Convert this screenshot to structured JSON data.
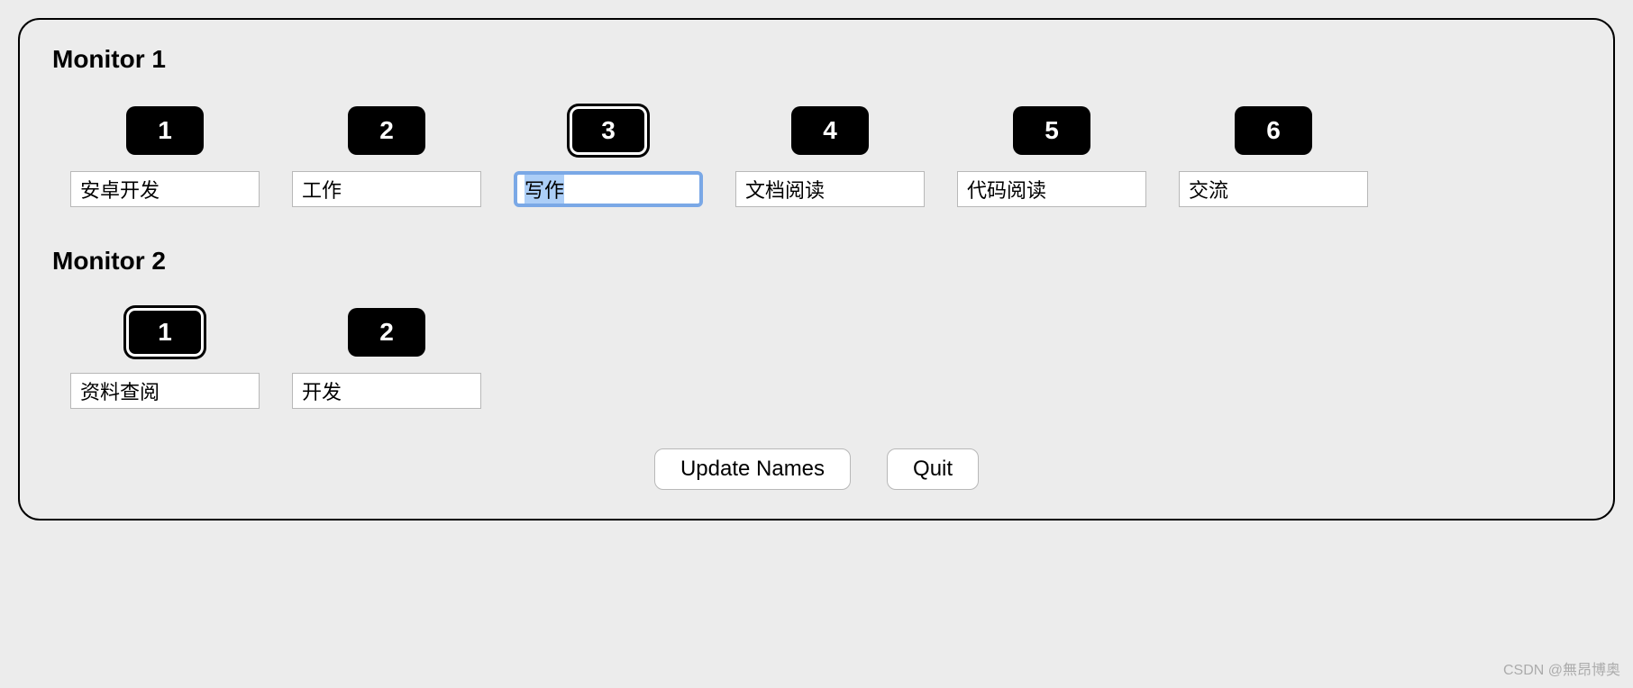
{
  "monitors": [
    {
      "heading": "Monitor 1",
      "spaces": [
        {
          "num": "1",
          "name": "安卓开发",
          "active": false,
          "focused": false
        },
        {
          "num": "2",
          "name": "工作",
          "active": false,
          "focused": false
        },
        {
          "num": "3",
          "name": "写作",
          "active": true,
          "focused": true
        },
        {
          "num": "4",
          "name": "文档阅读",
          "active": false,
          "focused": false
        },
        {
          "num": "5",
          "name": "代码阅读",
          "active": false,
          "focused": false
        },
        {
          "num": "6",
          "name": "交流",
          "active": false,
          "focused": false
        }
      ]
    },
    {
      "heading": "Monitor 2",
      "spaces": [
        {
          "num": "1",
          "name": "资料查阅",
          "active": true,
          "focused": false
        },
        {
          "num": "2",
          "name": "开发",
          "active": false,
          "focused": false
        }
      ]
    }
  ],
  "buttons": {
    "update": "Update Names",
    "quit": "Quit"
  },
  "watermark": "CSDN @無昂博奥"
}
